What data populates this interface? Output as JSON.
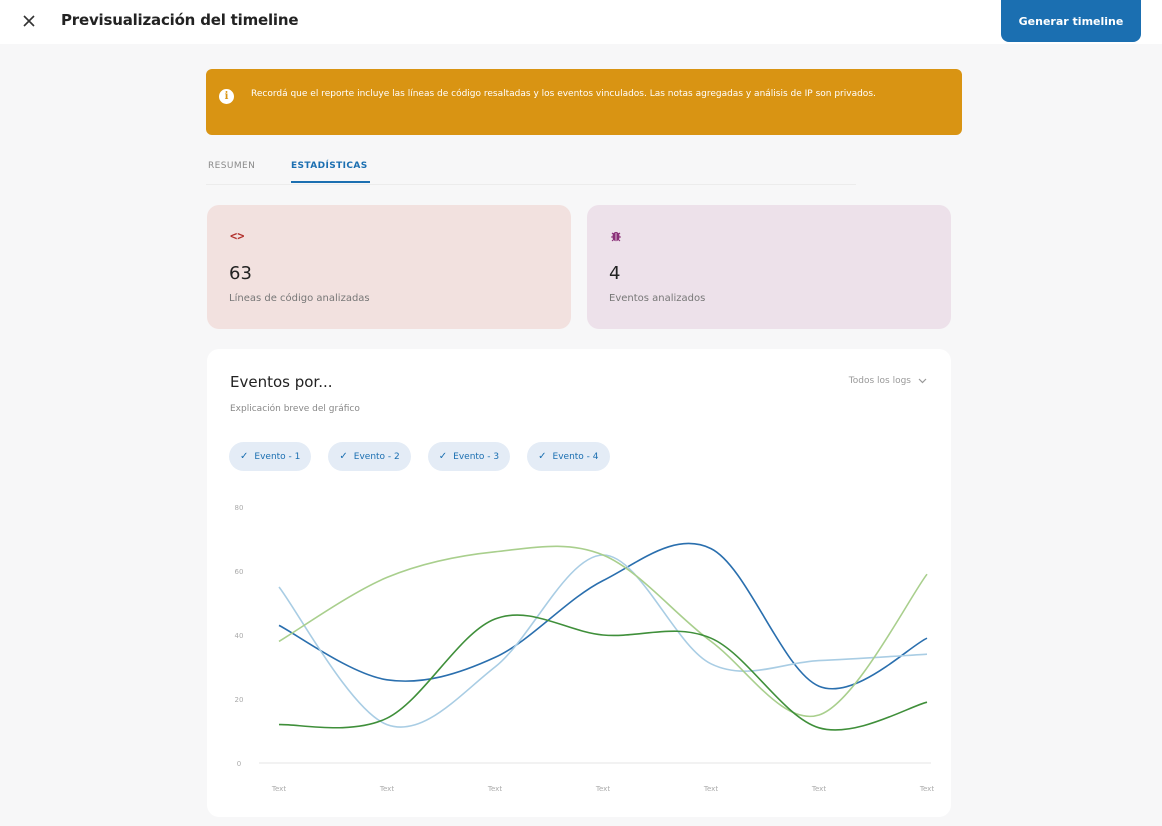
{
  "header": {
    "title": "Previsualización del timeline",
    "generate_label": "Generar timeline"
  },
  "alert": {
    "icon": "info-icon",
    "text": "Recordá que el reporte incluye las líneas de código resaltadas y los eventos vinculados. Las notas agregadas y análisis de IP son privados."
  },
  "tabs": [
    {
      "label": "RESUMEN",
      "active": false
    },
    {
      "label": "ESTADÍSTICAS",
      "active": true
    }
  ],
  "stats": {
    "code": {
      "icon": "code-icon",
      "value": "63",
      "label": "Líneas de código analizadas",
      "color": "#b3322e"
    },
    "events": {
      "icon": "bug-icon",
      "value": "4",
      "label": "Eventos analizados",
      "color": "#8a2f78"
    }
  },
  "chart_card": {
    "title": "Eventos por...",
    "subtitle": "Explicación breve del gráfico",
    "filter_label": "Todos los logs",
    "chips": [
      "Evento - 1",
      "Evento - 2",
      "Evento - 3",
      "Evento - 4"
    ]
  },
  "chart_data": {
    "type": "line",
    "x": [
      "Text",
      "Text",
      "Text",
      "Text",
      "Text",
      "Text",
      "Text"
    ],
    "y_ticks": [
      0,
      20,
      40,
      60,
      80
    ],
    "ylim": [
      0,
      80
    ],
    "grid": false,
    "series": [
      {
        "name": "Evento - 1",
        "color": "#2a6fae",
        "values": [
          43,
          26,
          33,
          57,
          67,
          24,
          39
        ]
      },
      {
        "name": "Evento - 2",
        "color": "#a9cde4",
        "values": [
          55,
          12,
          30,
          65,
          31,
          32,
          34
        ]
      },
      {
        "name": "Evento - 3",
        "color": "#a9cf8d",
        "values": [
          38,
          58,
          66,
          65,
          38,
          15,
          59
        ]
      },
      {
        "name": "Evento - 4",
        "color": "#3f8f3a",
        "values": [
          12,
          14,
          45,
          40,
          39,
          11,
          19
        ]
      }
    ]
  }
}
